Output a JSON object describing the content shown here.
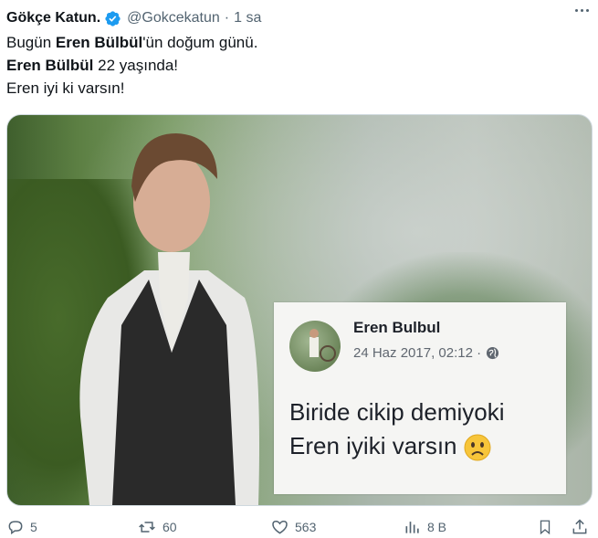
{
  "tweet": {
    "author_name": "Gökçe Katun.",
    "handle": "@Gokcekatun",
    "separator": "·",
    "time": "1 sa",
    "line1_pre": "Bugün ",
    "line1_bold": "Eren Bülbül",
    "line1_post": "'ün doğum günü.",
    "line2_bold": "Eren Bülbül",
    "line2_post": " 22 yaşında!",
    "line3": "Eren iyi ki varsın!"
  },
  "card": {
    "name": "Eren Bulbul",
    "date": "24 Haz 2017, 02:12 ·",
    "message_line1": "Biride cikip demiyoki",
    "message_line2": "Eren iyiki varsın"
  },
  "actions": {
    "replies": "5",
    "retweets": "60",
    "likes": "563",
    "views": "8 B"
  },
  "colors": {
    "verified": "#1d9bf0",
    "muted": "#536471",
    "text": "#0f1419"
  }
}
